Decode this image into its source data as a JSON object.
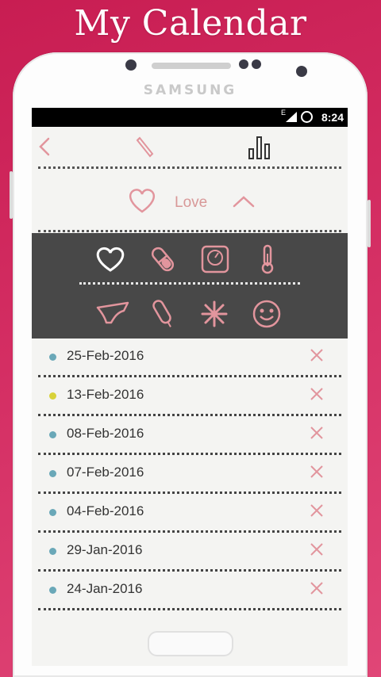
{
  "promo": {
    "title": "My Calendar"
  },
  "device": {
    "brand": "SAMSUNG"
  },
  "statusbar": {
    "network": "E",
    "time": "8:24"
  },
  "toolbar": {
    "icons": [
      "back-chevron-icon",
      "pencil-icon",
      "bar-chart-icon"
    ]
  },
  "category": {
    "label": "Love",
    "icon": "heart-icon",
    "toggle_icon": "chevron-up-icon"
  },
  "symptom_grid": {
    "row1": [
      "heart-icon",
      "pill-icon",
      "scale-icon",
      "thermometer-icon"
    ],
    "row2": [
      "underwear-icon",
      "tampon-icon",
      "cramp-burst-icon",
      "smiley-icon"
    ]
  },
  "entries": [
    {
      "date": "25-Feb-2016",
      "color": "#6aa8b8"
    },
    {
      "date": "13-Feb-2016",
      "color": "#d8d23a"
    },
    {
      "date": "08-Feb-2016",
      "color": "#6aa8b8"
    },
    {
      "date": "07-Feb-2016",
      "color": "#6aa8b8"
    },
    {
      "date": "04-Feb-2016",
      "color": "#6aa8b8"
    },
    {
      "date": "29-Jan-2016",
      "color": "#6aa8b8"
    },
    {
      "date": "24-Jan-2016",
      "color": "#6aa8b8"
    }
  ],
  "accent": "#e2959d"
}
